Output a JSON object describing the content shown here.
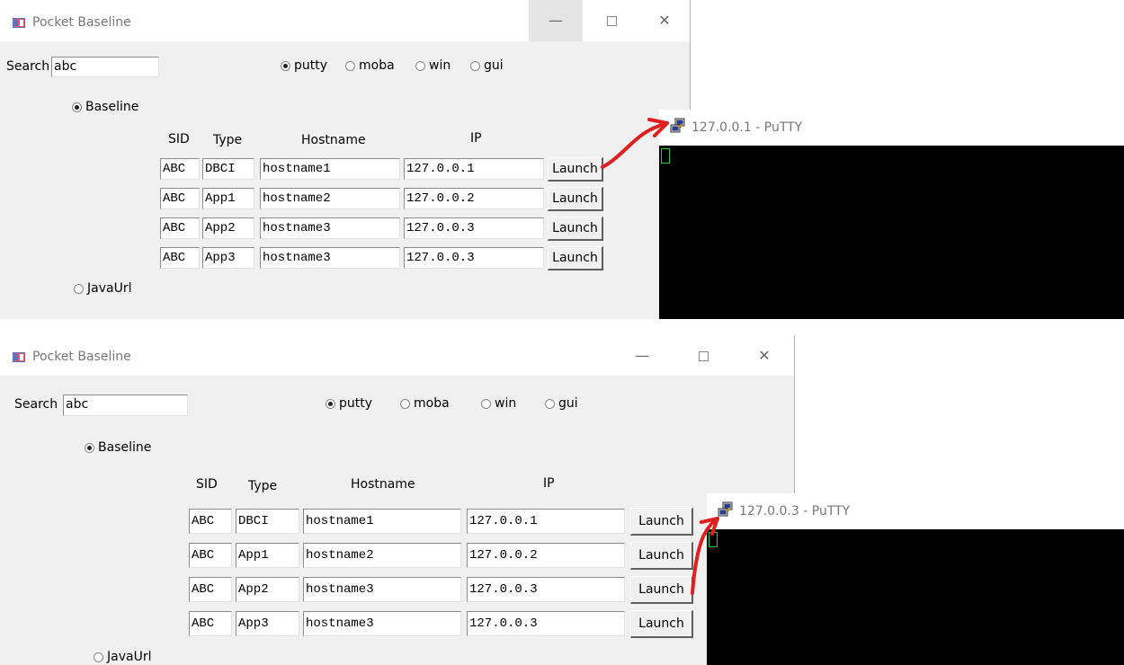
{
  "screens": [
    {
      "window_title": "Pocket Baseline",
      "titlebar_buttons": {
        "minimize": "—",
        "close": "✕"
      },
      "search": {
        "label": "Search",
        "value": "abc"
      },
      "clients": [
        "putty",
        "moba",
        "win",
        "gui"
      ],
      "selected_client": "putty",
      "modes": {
        "baseline": "Baseline",
        "javaurl": "JavaUrl",
        "selected": "Baseline"
      },
      "columns": [
        "SID",
        "Type",
        "Hostname",
        "IP"
      ],
      "rows": [
        {
          "sid": "ABC",
          "type": "DBCI",
          "hostname": "hostname1",
          "ip": "127.0.0.1",
          "action": "Launch"
        },
        {
          "sid": "ABC",
          "type": "App1",
          "hostname": "hostname2",
          "ip": "127.0.0.2",
          "action": "Launch"
        },
        {
          "sid": "ABC",
          "type": "App2",
          "hostname": "hostname3",
          "ip": "127.0.0.3",
          "action": "Launch"
        },
        {
          "sid": "ABC",
          "type": "App3",
          "hostname": "hostname3",
          "ip": "127.0.0.3",
          "action": "Launch"
        }
      ],
      "putty_title": "127.0.0.1 - PuTTY",
      "launched_row": 0
    },
    {
      "window_title": "Pocket Baseline",
      "titlebar_buttons": {
        "minimize": "—",
        "close": "✕"
      },
      "search": {
        "label": "Search",
        "value": "abc"
      },
      "clients": [
        "putty",
        "moba",
        "win",
        "gui"
      ],
      "selected_client": "putty",
      "modes": {
        "baseline": "Baseline",
        "javaurl": "JavaUrl",
        "selected": "Baseline"
      },
      "columns": [
        "SID",
        "Type",
        "Hostname",
        "IP"
      ],
      "rows": [
        {
          "sid": "ABC",
          "type": "DBCI",
          "hostname": "hostname1",
          "ip": "127.0.0.1",
          "action": "Launch"
        },
        {
          "sid": "ABC",
          "type": "App1",
          "hostname": "hostname2",
          "ip": "127.0.0.2",
          "action": "Launch"
        },
        {
          "sid": "ABC",
          "type": "App2",
          "hostname": "hostname3",
          "ip": "127.0.0.3",
          "action": "Launch"
        },
        {
          "sid": "ABC",
          "type": "App3",
          "hostname": "hostname3",
          "ip": "127.0.0.3",
          "action": "Launch"
        }
      ],
      "putty_title": "127.0.0.3 - PuTTY",
      "launched_row": 2
    }
  ],
  "colors": {
    "arrow": "#e02020",
    "terminal_bg": "#000000",
    "terminal_cursor": "#2ecc40",
    "window_bg": "#f0f0f0"
  }
}
